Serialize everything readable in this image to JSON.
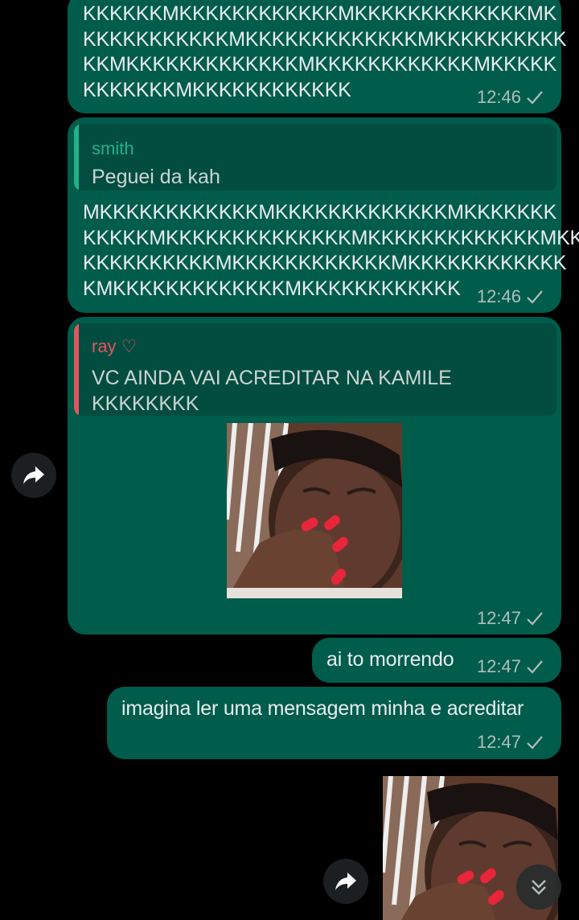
{
  "messages": [
    {
      "text": "KKKKKKMKKKKKKKKKKKKMKKKKKKKKKKKKKMK\nKKKKKKKKKKKMKKKKKKKKKKKKKMKKKKKKKKKK\nKKMKKKKKKKKKKKKKMKKKKKKKKKKKKMKKKKK\nKKKKKKKMKKKKKKKKKKKK",
      "time": "12:46"
    },
    {
      "reply_author": "smith",
      "reply_text": "Peguei da kah",
      "text": "MKKKKKKKKKKKKMKKKKKKKKKKKKKMKKKKKKK\nKKKKKMKKKKKKKKKKKKKKMKKKKKKKKKKKKKMKK\nKKKKKKKKKKMKKKKKKKKKKKKMKKKKKKKKKKKK\nKMKKKKKKKKKKKKKMKKKKKKKKKKKK",
      "time": "12:46"
    },
    {
      "reply_author": "ray ♡",
      "reply_text": "VC AINDA VAI ACREDITAR NA KAMILE\nKKKKKKKK",
      "sticker": "laughing-person-sticker",
      "time": "12:47"
    },
    {
      "text": "ai to morrendo",
      "time": "12:47"
    },
    {
      "text": "imagina ler uma mensagem minha e acreditar",
      "time": "12:47"
    }
  ],
  "colors": {
    "background": "#000000",
    "bubble_out": "#005c4b",
    "reply_bg": "#024d40",
    "smith_accent": "#25b089",
    "ray_accent": "#e0575f",
    "meta": "#aebfbb"
  },
  "icons": {
    "forward": "forward-arrow-icon",
    "scroll_down": "double-chevron-down-icon",
    "read_status": "single-check-icon"
  }
}
